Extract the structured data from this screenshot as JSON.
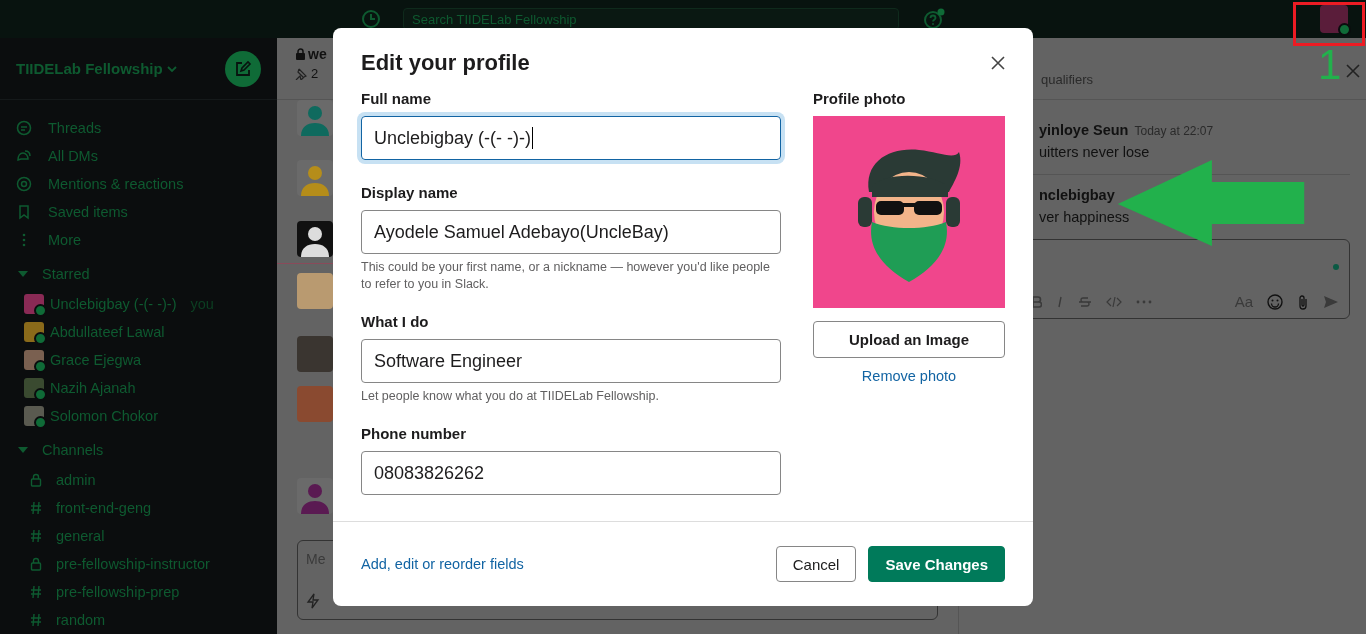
{
  "top_bar": {
    "search_placeholder": "Search TIIDELab Fellowship"
  },
  "sidebar": {
    "workspace": "TIIDELab Fellowship",
    "nav": [
      {
        "label": "Threads"
      },
      {
        "label": "All DMs"
      },
      {
        "label": "Mentions & reactions"
      },
      {
        "label": "Saved items"
      },
      {
        "label": "More"
      }
    ],
    "sections": [
      {
        "title": "Starred",
        "expanded": true,
        "kind": "people",
        "items": [
          {
            "name": "Unclebigbay (-(- -)-)",
            "suffix": "you",
            "color": "#8a2a55"
          },
          {
            "name": "Abdullateef Lawal",
            "color": "#8a6a1a"
          },
          {
            "name": "Grace Ejegwa",
            "color": "#7a6050"
          },
          {
            "name": "Nazih Ajanah",
            "color": "#3a4a30"
          },
          {
            "name": "Solomon Chokor",
            "color": "#5a5a50"
          }
        ]
      },
      {
        "title": "Channels",
        "expanded": true,
        "kind": "channels",
        "items": [
          {
            "name": "admin",
            "private": true
          },
          {
            "name": "front-end-geng",
            "private": false
          },
          {
            "name": "general",
            "private": false
          },
          {
            "name": "pre-fellowship-instructor",
            "private": true
          },
          {
            "name": "pre-fellowship-prep",
            "private": false
          },
          {
            "name": "random",
            "private": false
          }
        ]
      }
    ]
  },
  "channel": {
    "title": "we",
    "pins": "2",
    "composer_placeholder": "Me"
  },
  "thread_panel": {
    "subtitle": "qualifiers",
    "format_label": "Aa",
    "messages": [
      {
        "author": "yinloye Seun",
        "time": "Today at 22:07",
        "text": "uitters never lose"
      },
      {
        "author": "nclebigbay",
        "text": "ver happiness"
      }
    ]
  },
  "modal": {
    "title": "Edit your profile",
    "fields": [
      {
        "label": "Full name",
        "value": "Unclebigbay (-(- -)-)",
        "focused": true
      },
      {
        "label": "Display name",
        "value": "Ayodele Samuel Adebayo(UncleBay)",
        "focused": false,
        "hint": "This could be your first name, or a nickname — however you'd like people to refer to you in Slack."
      },
      {
        "label": "What I do",
        "value": "Software Engineer",
        "focused": false,
        "hint": "Let people know what you do at TIIDELab Fellowship."
      },
      {
        "label": "Phone number",
        "value": "08083826262",
        "focused": false
      }
    ],
    "photo_label": "Profile photo",
    "upload_button": "Upload an Image",
    "remove_link": "Remove photo",
    "footer_link": "Add, edit or reorder fields",
    "cancel_button": "Cancel",
    "save_button": "Save Changes"
  },
  "annotation": {
    "number": "1"
  }
}
